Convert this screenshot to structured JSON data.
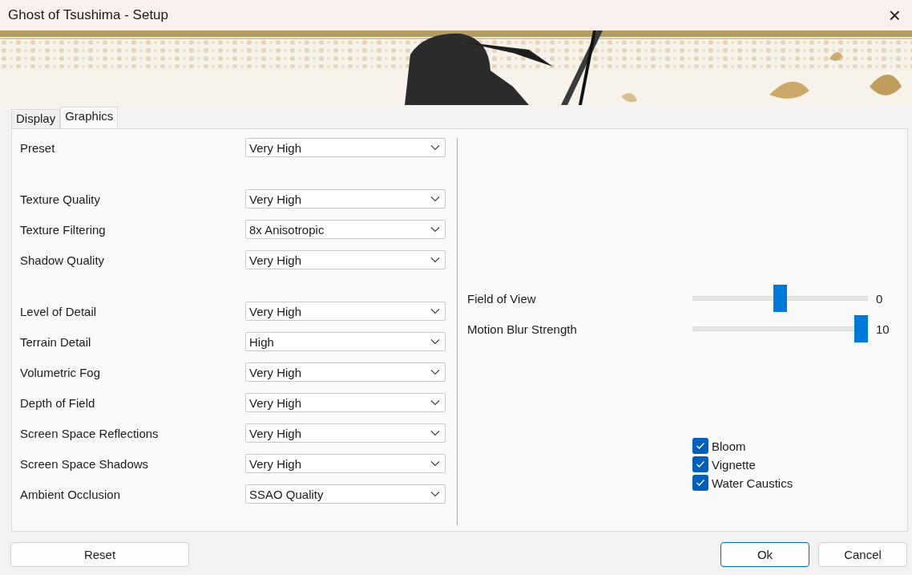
{
  "window": {
    "title": "Ghost of Tsushima - Setup",
    "close": "×"
  },
  "tabs": [
    {
      "label": "Display",
      "selected": false
    },
    {
      "label": "Graphics",
      "selected": true
    }
  ],
  "setting_groups": [
    {
      "settings": [
        {
          "label": "Preset",
          "value": "Very High"
        }
      ]
    },
    {
      "settings": [
        {
          "label": "Texture Quality",
          "value": "Very High"
        },
        {
          "label": "Texture Filtering",
          "value": "8x Anisotropic"
        },
        {
          "label": "Shadow Quality",
          "value": "Very High"
        }
      ]
    },
    {
      "settings": [
        {
          "label": "Level of Detail",
          "value": "Very High"
        },
        {
          "label": "Terrain Detail",
          "value": "High"
        },
        {
          "label": "Volumetric Fog",
          "value": "Very High"
        },
        {
          "label": "Depth of Field",
          "value": "Very High"
        },
        {
          "label": "Screen Space Reflections",
          "value": "Very High"
        },
        {
          "label": "Screen Space Shadows",
          "value": "Very High"
        },
        {
          "label": "Ambient Occlusion",
          "value": "SSAO Quality"
        }
      ]
    }
  ],
  "sliders": [
    {
      "label": "Field of View",
      "level": 0.5,
      "reading": "0"
    },
    {
      "label": "Motion Blur Strength",
      "level": 1.0,
      "reading": "10"
    }
  ],
  "checkboxes": [
    {
      "label": "Bloom",
      "checked": true
    },
    {
      "label": "Vignette",
      "checked": true
    },
    {
      "label": "Water Caustics",
      "checked": true
    }
  ],
  "buttons": [
    {
      "label": "Reset",
      "kind": "secondary"
    },
    {
      "label": "Ok",
      "kind": "default"
    },
    {
      "label": "Cancel",
      "kind": "secondary"
    }
  ]
}
